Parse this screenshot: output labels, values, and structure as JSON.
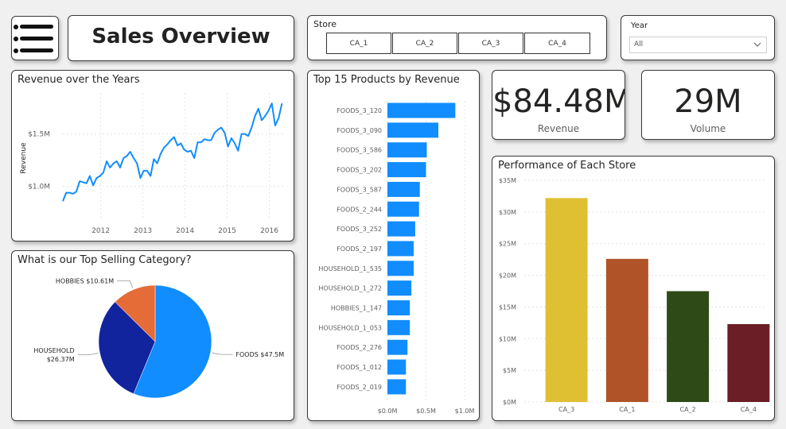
{
  "header": {
    "title": "Sales Overview",
    "menu_icon": "hamburger-menu-icon"
  },
  "filters": {
    "store": {
      "label": "Store",
      "options": [
        "CA_1",
        "CA_2",
        "CA_3",
        "CA_4"
      ]
    },
    "year": {
      "label": "Year",
      "selected": "All"
    }
  },
  "kpis": {
    "revenue": {
      "value": "$84.48M",
      "label": "Revenue"
    },
    "volume": {
      "value": "29M",
      "label": "Volume"
    }
  },
  "colors": {
    "accent": "#118dff",
    "dark_blue": "#12239e",
    "orange": "#e66c37",
    "ca3": "#e0c033",
    "ca1": "#b05328",
    "ca2": "#2e4a17",
    "ca4": "#6b1e26"
  },
  "chart_data": [
    {
      "id": "revenue_over_years",
      "type": "line",
      "title": "Revenue over the Years",
      "ylabel": "Revenue",
      "xlabel": "",
      "x_ticks": [
        2012,
        2013,
        2014,
        2015,
        2016
      ],
      "y_ticks": [
        {
          "value": 1.0,
          "label": "$1.0M"
        },
        {
          "value": 1.5,
          "label": "$1.5M"
        }
      ],
      "xlim": [
        2011.1,
        2016.33
      ],
      "ylim": [
        0.68,
        1.89
      ],
      "series": [
        {
          "color": "#118dff",
          "x": [
            2011.1,
            2011.18,
            2011.26,
            2011.34,
            2011.42,
            2011.5,
            2011.58,
            2011.66,
            2011.74,
            2011.82,
            2011.9,
            2011.98,
            2012.06,
            2012.14,
            2012.22,
            2012.3,
            2012.38,
            2012.46,
            2012.54,
            2012.62,
            2012.7,
            2012.78,
            2012.86,
            2012.94,
            2013.02,
            2013.1,
            2013.18,
            2013.26,
            2013.34,
            2013.42,
            2013.5,
            2013.58,
            2013.66,
            2013.74,
            2013.82,
            2013.9,
            2013.98,
            2014.06,
            2014.14,
            2014.22,
            2014.3,
            2014.38,
            2014.46,
            2014.54,
            2014.62,
            2014.7,
            2014.78,
            2014.86,
            2014.94,
            2015.02,
            2015.1,
            2015.18,
            2015.26,
            2015.34,
            2015.42,
            2015.5,
            2015.58,
            2015.66,
            2015.74,
            2015.82,
            2015.9,
            2015.98,
            2016.06,
            2016.14,
            2016.22,
            2016.3
          ],
          "y": [
            0.86,
            0.94,
            0.94,
            0.93,
            0.95,
            1.05,
            1.04,
            1.03,
            1.1,
            1.01,
            1.08,
            1.1,
            1.13,
            1.24,
            1.18,
            1.22,
            1.24,
            1.18,
            1.27,
            1.29,
            1.33,
            1.27,
            1.22,
            1.08,
            1.15,
            1.15,
            1.1,
            1.26,
            1.22,
            1.31,
            1.37,
            1.4,
            1.44,
            1.47,
            1.39,
            1.41,
            1.35,
            1.33,
            1.34,
            1.27,
            1.42,
            1.42,
            1.45,
            1.44,
            1.44,
            1.51,
            1.54,
            1.56,
            1.51,
            1.38,
            1.46,
            1.41,
            1.34,
            1.5,
            1.5,
            1.48,
            1.56,
            1.67,
            1.74,
            1.63,
            1.67,
            1.72,
            1.79,
            1.58,
            1.65,
            1.79
          ]
        }
      ]
    },
    {
      "id": "top_15_products",
      "type": "bar",
      "orientation": "horizontal",
      "title": "Top 15 Products by Revenue",
      "categories": [
        "FOODS_3_120",
        "FOODS_3_090",
        "FOODS_3_586",
        "FOODS_3_202",
        "FOODS_3_587",
        "FOODS_2_244",
        "FOODS_3_252",
        "FOODS_2_197",
        "HOUSEHOLD_1_535",
        "HOUSEHOLD_1_272",
        "HOBBIES_1_147",
        "HOUSEHOLD_1_053",
        "FOODS_2_276",
        "FOODS_1_012",
        "FOODS_2_019"
      ],
      "values": [
        0.88,
        0.66,
        0.51,
        0.5,
        0.42,
        0.41,
        0.36,
        0.34,
        0.34,
        0.31,
        0.29,
        0.29,
        0.26,
        0.24,
        0.24
      ],
      "x_ticks": [
        {
          "value": 0,
          "label": "$0.0M"
        },
        {
          "value": 0.5,
          "label": "$0.5M"
        },
        {
          "value": 1.0,
          "label": "$1.0M"
        }
      ],
      "xlim": [
        0,
        1.0
      ],
      "color": "#118dff"
    },
    {
      "id": "top_selling_category",
      "type": "pie",
      "title": "What is our Top Selling Category?",
      "slices": [
        {
          "name": "FOODS",
          "value": 47.5,
          "label": "FOODS $47.5M",
          "color": "#118dff"
        },
        {
          "name": "HOUSEHOLD",
          "value": 26.37,
          "label_lines": [
            "HOUSEHOLD",
            "$26.37M"
          ],
          "color": "#12239e"
        },
        {
          "name": "HOBBIES",
          "value": 10.61,
          "label": "HOBBIES $10.61M",
          "color": "#e66c37"
        }
      ]
    },
    {
      "id": "store_performance",
      "type": "bar",
      "title": "Performance of Each Store",
      "categories": [
        "CA_3",
        "CA_1",
        "CA_2",
        "CA_4"
      ],
      "values": [
        32.2,
        22.6,
        17.5,
        12.3
      ],
      "colors": [
        "#e0c033",
        "#b05328",
        "#2e4a17",
        "#6b1e26"
      ],
      "y_ticks": [
        {
          "value": 0,
          "label": "$0M"
        },
        {
          "value": 5,
          "label": "$5M"
        },
        {
          "value": 10,
          "label": "$10M"
        },
        {
          "value": 15,
          "label": "$15M"
        },
        {
          "value": 20,
          "label": "$20M"
        },
        {
          "value": 25,
          "label": "$25M"
        },
        {
          "value": 30,
          "label": "$30M"
        },
        {
          "value": 35,
          "label": "$35M"
        }
      ],
      "ylim": [
        0,
        35
      ]
    }
  ]
}
